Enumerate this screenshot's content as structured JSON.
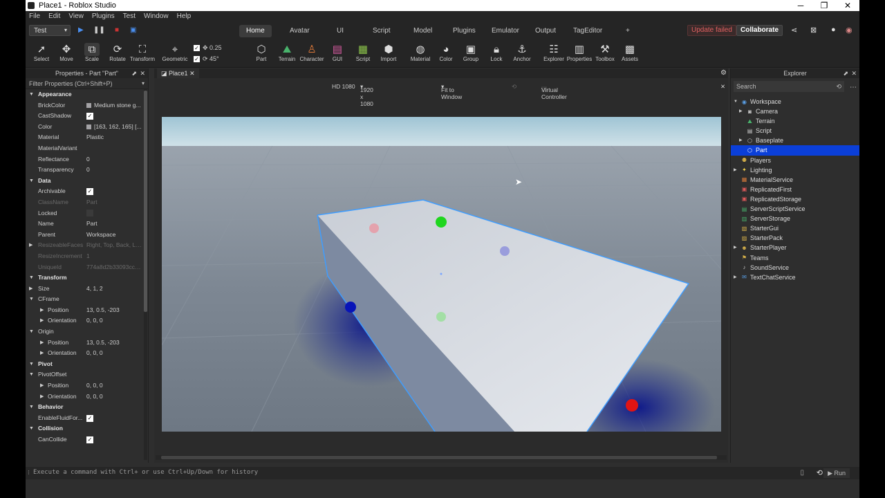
{
  "window": {
    "title": "Place1 - Roblox Studio",
    "controls": [
      "─",
      "❐",
      "✕"
    ]
  },
  "menu": [
    "File",
    "Edit",
    "View",
    "Plugins",
    "Test",
    "Window",
    "Help"
  ],
  "ribbon": {
    "place_selector": "Test",
    "tabs": [
      "Home",
      "Avatar",
      "UI",
      "Script",
      "Model",
      "Plugins",
      "Emulator",
      "Output",
      "TagEditor",
      "+"
    ],
    "active_tab": "Home",
    "update_failed": "Update failed",
    "collaborate": "Collaborate"
  },
  "toolbar": {
    "tools": [
      {
        "label": "Select",
        "icon": "cursor-icon"
      },
      {
        "label": "Move",
        "icon": "move-icon"
      },
      {
        "label": "Scale",
        "icon": "scale-icon"
      },
      {
        "label": "Rotate",
        "icon": "rotate-icon"
      },
      {
        "label": "Transform",
        "icon": "transform-icon"
      },
      {
        "label": "Geometric",
        "icon": "geometric-icon"
      },
      {
        "label": "Part",
        "icon": "part-icon"
      },
      {
        "label": "Terrain",
        "icon": "terrain-icon"
      },
      {
        "label": "Character",
        "icon": "character-icon"
      },
      {
        "label": "GUI",
        "icon": "gui-icon"
      },
      {
        "label": "Script",
        "icon": "script-icon"
      },
      {
        "label": "Import",
        "icon": "import-icon"
      },
      {
        "label": "Material",
        "icon": "material-icon"
      },
      {
        "label": "Color",
        "icon": "color-icon"
      },
      {
        "label": "Group",
        "icon": "group-icon"
      },
      {
        "label": "Lock",
        "icon": "lock-icon"
      },
      {
        "label": "Anchor",
        "icon": "anchor-icon"
      },
      {
        "label": "Explorer",
        "icon": "explorer-icon"
      },
      {
        "label": "Properties",
        "icon": "properties-icon"
      },
      {
        "label": "Toolbox",
        "icon": "toolbox-icon"
      },
      {
        "label": "Assets",
        "icon": "assets-icon"
      }
    ],
    "move_snap": "0.25",
    "rotate_snap": "45°"
  },
  "properties": {
    "title": "Properties - Part \"Part\"",
    "filter_placeholder": "Filter Properties (Ctrl+Shift+P)",
    "rows": [
      {
        "type": "cat",
        "name": "Appearance"
      },
      {
        "name": "BrickColor",
        "value": "Medium stone g...",
        "swatch": "#a3a2a5"
      },
      {
        "name": "CastShadow",
        "check": true
      },
      {
        "name": "Color",
        "value": "[163, 162, 165] [...",
        "swatch": "#a3a2a5"
      },
      {
        "name": "Material",
        "value": "Plastic"
      },
      {
        "name": "MaterialVariant",
        "value": ""
      },
      {
        "name": "Reflectance",
        "value": "0"
      },
      {
        "name": "Transparency",
        "value": "0"
      },
      {
        "type": "cat",
        "name": "Data"
      },
      {
        "name": "Archivable",
        "check": true
      },
      {
        "name": "ClassName",
        "value": "Part",
        "dim": true
      },
      {
        "name": "Locked",
        "check": false
      },
      {
        "name": "Name",
        "value": "Part"
      },
      {
        "name": "Parent",
        "value": "Workspace"
      },
      {
        "name": "ResizeableFaces",
        "value": "Right, Top, Back, Le...",
        "dim": true,
        "expand": true
      },
      {
        "name": "ResizeIncrement",
        "value": "1",
        "dim": true
      },
      {
        "name": "UniqueId",
        "value": "774a8d2b33093cc72...",
        "dim": true
      },
      {
        "type": "cat",
        "name": "Transform"
      },
      {
        "name": "Size",
        "value": "4, 1, 2",
        "expand": true
      },
      {
        "name": "CFrame",
        "open": true
      },
      {
        "name": "Position",
        "value": "13, 0.5, -203",
        "sub2": true
      },
      {
        "name": "Orientation",
        "value": "0, 0, 0",
        "sub2": true
      },
      {
        "name": "Origin",
        "open": true
      },
      {
        "name": "Position",
        "value": "13, 0.5, -203",
        "sub2": true
      },
      {
        "name": "Orientation",
        "value": "0, 0, 0",
        "sub2": true
      },
      {
        "type": "cat",
        "name": "Pivot"
      },
      {
        "name": "PivotOffset",
        "open": true
      },
      {
        "name": "Position",
        "value": "0, 0, 0",
        "sub2": true
      },
      {
        "name": "Orientation",
        "value": "0, 0, 0",
        "sub2": true
      },
      {
        "type": "cat",
        "name": "Behavior"
      },
      {
        "name": "EnableFluidFor...",
        "check": true
      },
      {
        "type": "cat",
        "name": "Collision"
      },
      {
        "name": "CanCollide",
        "check": true
      }
    ]
  },
  "viewport": {
    "tab": "Place1",
    "resolution": "HD 1080",
    "size": "1920 x 1080",
    "fit": "Fit to Window",
    "virtual_controller": "Virtual Controller"
  },
  "explorer": {
    "title": "Explorer",
    "search_placeholder": "Search",
    "items": [
      {
        "label": "Workspace",
        "indent": 0,
        "arrow": "open",
        "icon": "workspace-icon",
        "color": "#5aa0e8"
      },
      {
        "label": "Camera",
        "indent": 1,
        "arrow": "closed",
        "icon": "camera-icon",
        "color": "#cccccc"
      },
      {
        "label": "Terrain",
        "indent": 1,
        "arrow": "",
        "icon": "terrain-icon",
        "color": "#49b36c"
      },
      {
        "label": "Script",
        "indent": 1,
        "arrow": "",
        "icon": "script-icon",
        "color": "#cccccc"
      },
      {
        "label": "Baseplate",
        "indent": 1,
        "arrow": "closed",
        "icon": "part-icon",
        "color": "#cccccc"
      },
      {
        "label": "Part",
        "indent": 1,
        "arrow": "",
        "icon": "part-icon",
        "color": "#ffffff",
        "selected": true
      },
      {
        "label": "Players",
        "indent": 0,
        "arrow": "",
        "icon": "players-icon",
        "color": "#d8b24a"
      },
      {
        "label": "Lighting",
        "indent": 0,
        "arrow": "closed",
        "icon": "lighting-icon",
        "color": "#f0d04a"
      },
      {
        "label": "MaterialService",
        "indent": 0,
        "arrow": "",
        "icon": "material-service-icon",
        "color": "#d77a3a"
      },
      {
        "label": "ReplicatedFirst",
        "indent": 0,
        "arrow": "",
        "icon": "replicated-first-icon",
        "color": "#e05a5a"
      },
      {
        "label": "ReplicatedStorage",
        "indent": 0,
        "arrow": "",
        "icon": "replicated-storage-icon",
        "color": "#e05a5a"
      },
      {
        "label": "ServerScriptService",
        "indent": 0,
        "arrow": "",
        "icon": "server-script-service-icon",
        "color": "#49b36c"
      },
      {
        "label": "ServerStorage",
        "indent": 0,
        "arrow": "",
        "icon": "server-storage-icon",
        "color": "#49b36c"
      },
      {
        "label": "StarterGui",
        "indent": 0,
        "arrow": "",
        "icon": "starter-gui-icon",
        "color": "#d8b24a"
      },
      {
        "label": "StarterPack",
        "indent": 0,
        "arrow": "",
        "icon": "starter-pack-icon",
        "color": "#d8b24a"
      },
      {
        "label": "StarterPlayer",
        "indent": 0,
        "arrow": "closed",
        "icon": "starter-player-icon",
        "color": "#d8b24a"
      },
      {
        "label": "Teams",
        "indent": 0,
        "arrow": "",
        "icon": "teams-icon",
        "color": "#d8b24a"
      },
      {
        "label": "SoundService",
        "indent": 0,
        "arrow": "",
        "icon": "sound-service-icon",
        "color": "#cccccc"
      },
      {
        "label": "TextChatService",
        "indent": 0,
        "arrow": "closed",
        "icon": "text-chat-service-icon",
        "color": "#5aa0e8"
      }
    ]
  },
  "command_bar": {
    "placeholder": "Execute a command with Ctrl+ or use Ctrl+Up/Down for history",
    "run": "Run"
  }
}
